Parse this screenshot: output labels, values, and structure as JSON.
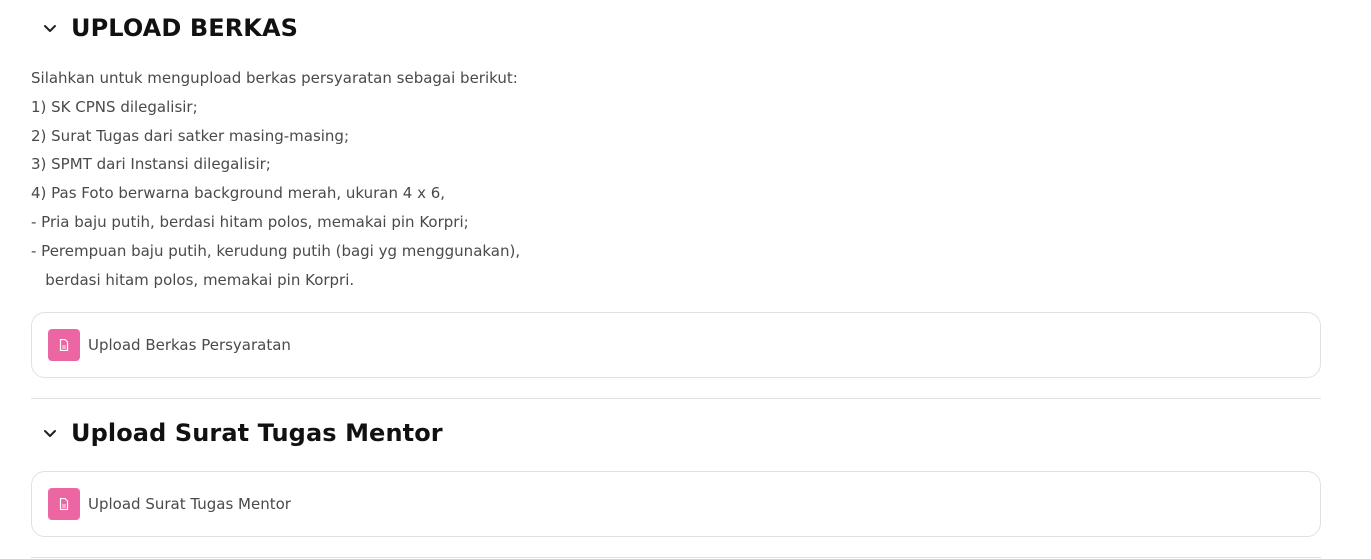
{
  "sections": [
    {
      "title": "UPLOAD BERKAS",
      "description": [
        "Silahkan untuk mengupload berkas persyaratan sebagai berikut:",
        "1) SK CPNS dilegalisir;",
        "2) Surat Tugas dari satker masing-masing;",
        "3) SPMT dari Instansi dilegalisir;",
        "4) Pas Foto berwarna background merah, ukuran 4 x 6,",
        "- Pria baju putih, berdasi hitam polos, memakai pin Korpri;",
        "- Perempuan baju putih, kerudung putih (bagi yg menggunakan),",
        "   berdasi hitam polos, memakai pin Korpri."
      ],
      "activity": {
        "label": "Upload Berkas Persyaratan",
        "icon": "file-icon"
      }
    },
    {
      "title": "Upload Surat Tugas Mentor",
      "activity": {
        "label": "Upload Surat Tugas Mentor",
        "icon": "file-icon"
      }
    }
  ],
  "colors": {
    "icon_bg": "#eb66a2",
    "border": "#dee2e6",
    "text": "#4a4a4a",
    "title": "#111111"
  }
}
